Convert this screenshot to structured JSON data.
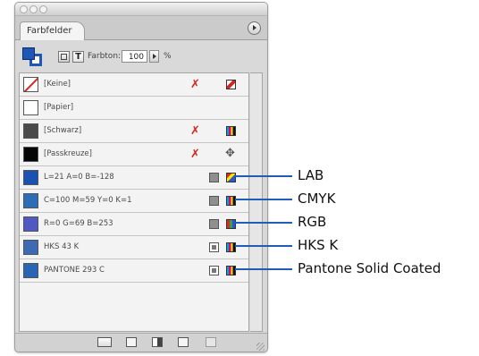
{
  "panel": {
    "tab_label": "Farbfelder",
    "tint_label": "Farbton:",
    "tint_value": "100",
    "tint_unit": "%",
    "stroke_fill_color": "#1e57b5"
  },
  "swatches": [
    {
      "name": "[Keine]",
      "color": "none",
      "locked": true,
      "type_icon": "",
      "mode_icon": "none-mode-icon"
    },
    {
      "name": "[Papier]",
      "color": "#ffffff",
      "locked": false,
      "type_icon": "",
      "mode_icon": ""
    },
    {
      "name": "[Schwarz]",
      "color": "#4a4a4a",
      "locked": true,
      "type_icon": "",
      "mode_icon": "cmyk-mode-icon"
    },
    {
      "name": "[Passkreuze]",
      "color": "#050505",
      "locked": true,
      "type_icon": "",
      "mode_icon": "registration-icon"
    },
    {
      "name": "L=21 A=0 B=-128",
      "color": "#1a52b3",
      "locked": false,
      "type_icon": "process",
      "mode_icon": "lab-mode-icon"
    },
    {
      "name": "C=100 M=59 Y=0 K=1",
      "color": "#2d6db8",
      "locked": false,
      "type_icon": "process",
      "mode_icon": "cmyk-mode-icon"
    },
    {
      "name": "R=0 G=69 B=253",
      "color": "#5058c4",
      "locked": false,
      "type_icon": "process",
      "mode_icon": "rgb-mode-icon"
    },
    {
      "name": "HKS 43 K",
      "color": "#3e69b5",
      "locked": false,
      "type_icon": "spot",
      "mode_icon": "cmyk-mode-icon"
    },
    {
      "name": "PANTONE 293 C",
      "color": "#2a64b4",
      "locked": false,
      "type_icon": "spot",
      "mode_icon": "cmyk-mode-icon"
    }
  ],
  "callouts": [
    "LAB",
    "CMYK",
    "RGB",
    "HKS K",
    "Pantone Solid Coated"
  ],
  "colors": {
    "callout_line": "#1f5db8",
    "lock_red": "#d3231c"
  }
}
